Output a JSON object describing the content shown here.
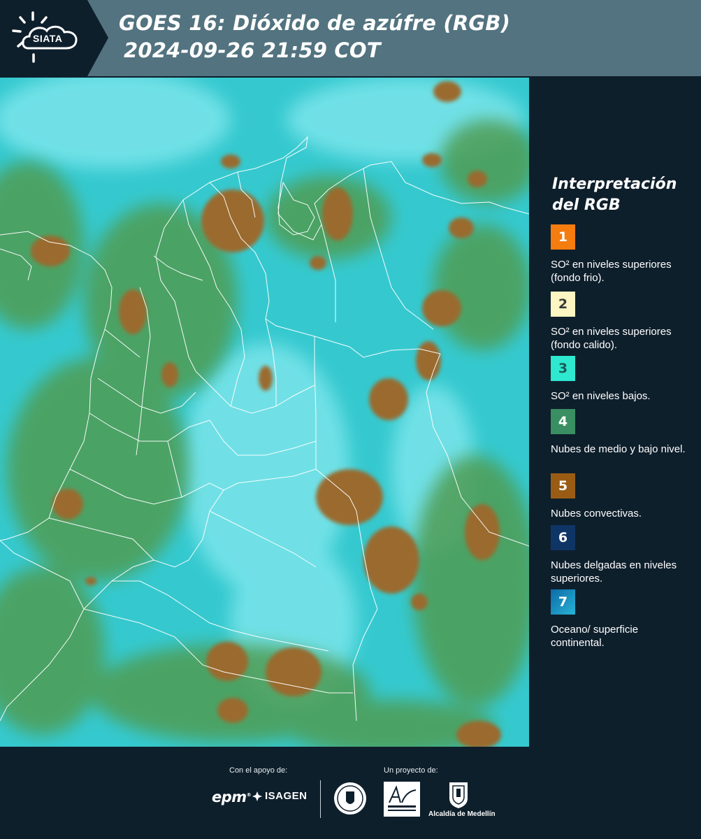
{
  "header": {
    "logo_text": "SIATA",
    "title_line1": "GOES 16: Dióxido de azúfre (RGB)",
    "title_line2": "2024-09-26 21:59 COT"
  },
  "map": {
    "icon": "satellite-rgb-map",
    "colors": {
      "background": "#35c9cf",
      "cloud_low": "#4f9c52",
      "convective": "#9a6a2f",
      "boundary": "#ffffff"
    }
  },
  "legend": {
    "title": "Interpretación del RGB",
    "items": [
      {
        "number": "1",
        "color": "#f57c0f",
        "text_color": "#ffffff",
        "label": "SO² en niveles superiores (fondo frio)."
      },
      {
        "number": "2",
        "color": "#fdf5c2",
        "text_color": "#3a3a3a",
        "label": "SO² en niveles superiores (fondo calido)."
      },
      {
        "number": "3",
        "color": "#2ee8cf",
        "text_color": "#1d5a55",
        "label": "SO² en niveles bajos."
      },
      {
        "number": "4",
        "color": "#3a8f62",
        "text_color": "#ffffff",
        "label": "Nubes de medio y bajo nivel."
      },
      {
        "number": "5",
        "color": "#9a5c14",
        "text_color": "#ffffff",
        "label": "Nubes convectivas."
      },
      {
        "number": "6",
        "color": "#0f3566",
        "text_color": "#ffffff",
        "label": "Nubes delgadas en niveles superiores."
      },
      {
        "number": "7",
        "color": "#1a93c2",
        "text_color": "#ffffff",
        "label": "Oceano/ superficie continental."
      }
    ]
  },
  "footer": {
    "support_caption": "Con el apoyo de:",
    "project_caption": "Un proyecto de:",
    "sponsors": [
      "epm",
      "ISAGEN"
    ],
    "partners": [
      "Área Metropolitana Valle de Aburrá",
      "Alcaldía de Medellín"
    ],
    "alcaldia_label": "Alcaldía de Medellín"
  }
}
